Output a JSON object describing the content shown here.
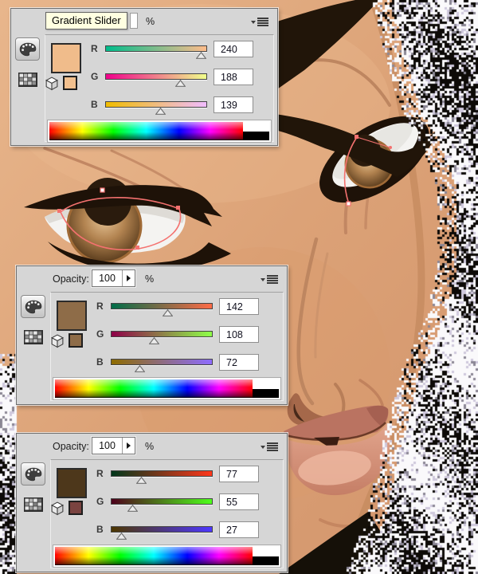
{
  "artwork": {
    "colors": {
      "skin": "#DCA277",
      "skin_shadow": "#C28763",
      "hair": "#1A1208",
      "iris": "#A06A36",
      "sclera": "#F4F3F1",
      "lips": "#C57E66",
      "selection_path_red": "#F4716F",
      "hair_dither_light": "#FAF9FB",
      "hair_dither_lavender": "#CFC8DC"
    }
  },
  "ui_colors": {
    "panel_bg": "#D6D6D6",
    "panel_border": "#6E6E6E",
    "tooltip_bg": "#FFFFE1",
    "input_bg": "#FFFFFF",
    "track_border": "#454545"
  },
  "icons": {
    "menu": "panel-menu-icon",
    "palette": "color-panel-icon",
    "swatches": "swatches-grid-icon",
    "cube": "3d-color-cube-icon",
    "spinner": "right-arrow-icon",
    "thumb": "slider-thumb-triangle"
  },
  "panels": [
    {
      "tooltip": "Gradient Slider",
      "percent": "%",
      "swatch": "#F0BC8B",
      "small_swatch": "#F2C08E",
      "channels": [
        {
          "label": "R",
          "value": "240",
          "track": [
            "#00BC8B",
            "#FFBC8B"
          ]
        },
        {
          "label": "G",
          "value": "188",
          "track": [
            "#F0008B",
            "#F0FF8B"
          ]
        },
        {
          "label": "B",
          "value": "139",
          "track": [
            "#F0BC00",
            "#F0BCFF"
          ]
        }
      ]
    },
    {
      "opacity_label": "Opacity:",
      "opacity_value": "100",
      "percent": "%",
      "swatch": "#8E6C48",
      "small_swatch": "#8E6C48",
      "channels": [
        {
          "label": "R",
          "value": "142",
          "track": [
            "#006C48",
            "#FF6C48"
          ]
        },
        {
          "label": "G",
          "value": "108",
          "track": [
            "#8E0048",
            "#8EFF48"
          ]
        },
        {
          "label": "B",
          "value": "72",
          "track": [
            "#8E6C00",
            "#8E6CFF"
          ]
        }
      ]
    },
    {
      "opacity_label": "Opacity:",
      "opacity_value": "100",
      "percent": "%",
      "swatch": "#4D371B",
      "small_swatch": "#7A4340",
      "channels": [
        {
          "label": "R",
          "value": "77",
          "track": [
            "#00371B",
            "#FF371B"
          ]
        },
        {
          "label": "G",
          "value": "55",
          "track": [
            "#4D001B",
            "#4DFF1B"
          ]
        },
        {
          "label": "B",
          "value": "27",
          "track": [
            "#4D3700",
            "#4D37FF"
          ]
        }
      ]
    }
  ]
}
